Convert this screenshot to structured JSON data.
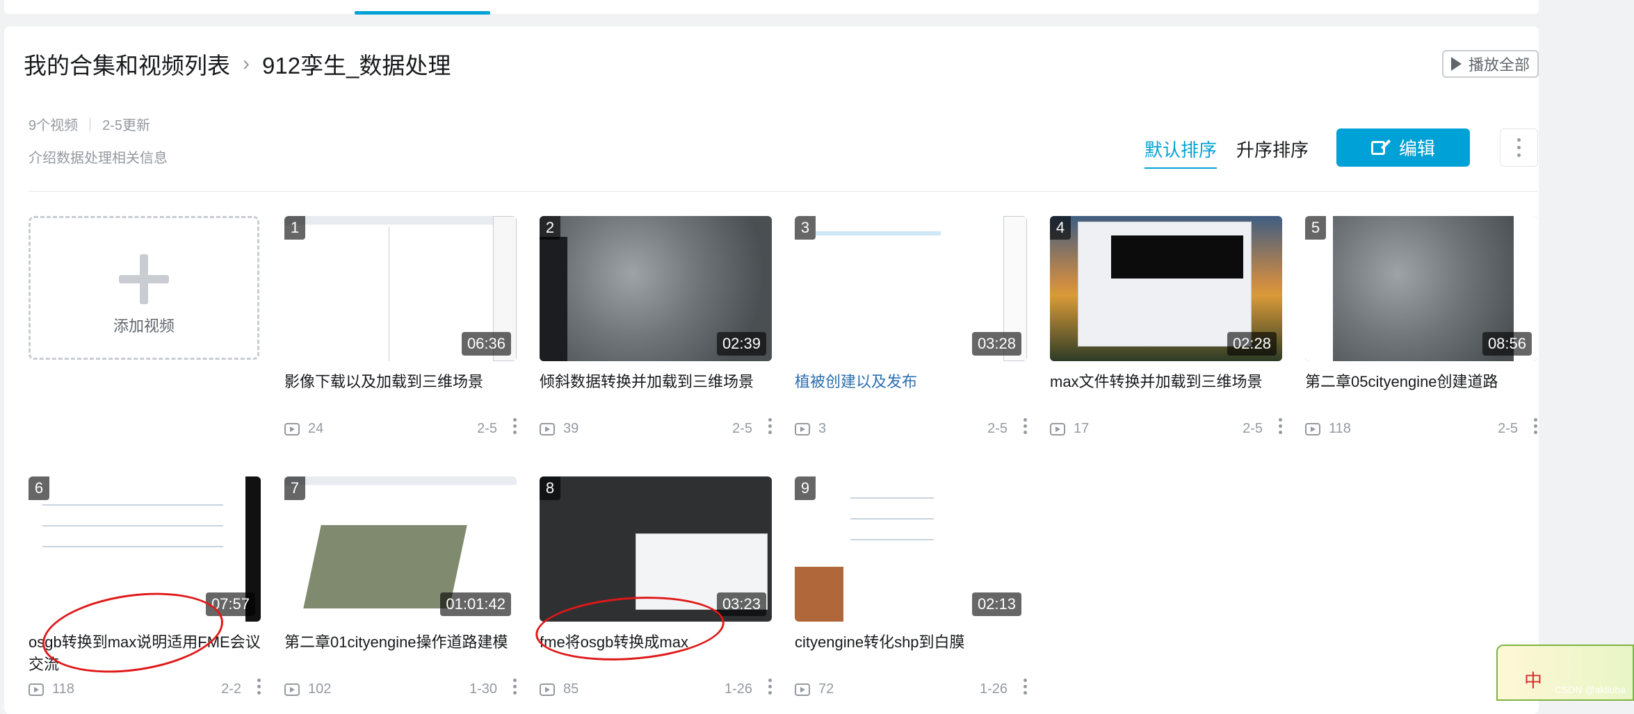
{
  "breadcrumb": {
    "root": "我的合集和视频列表",
    "current": "912孪生_数据处理"
  },
  "play_all": "播放全部",
  "meta": {
    "count": "9个视频",
    "updated": "2-5更新"
  },
  "description": "介绍数据处理相关信息",
  "sort": {
    "default": "默认排序",
    "asc": "升序排序"
  },
  "edit_label": "编辑",
  "add_video": "添加视频",
  "videos": [
    {
      "idx": "1",
      "duration": "06:36",
      "title": "影像下载以及加载到三维场景",
      "plays": "24",
      "date": "2-5"
    },
    {
      "idx": "2",
      "duration": "02:39",
      "title": "倾斜数据转换并加载到三维场景",
      "plays": "39",
      "date": "2-5"
    },
    {
      "idx": "3",
      "duration": "03:28",
      "title": "植被创建以及发布",
      "plays": "3",
      "date": "2-5"
    },
    {
      "idx": "4",
      "duration": "02:28",
      "title": "max文件转换并加载到三维场景",
      "plays": "17",
      "date": "2-5"
    },
    {
      "idx": "5",
      "duration": "08:56",
      "title": "第二章05cityengine创建道路",
      "plays": "118",
      "date": "2-5"
    },
    {
      "idx": "6",
      "duration": "07:57",
      "title": "osgb转换到max说明适用FME会议交流",
      "plays": "118",
      "date": "2-2"
    },
    {
      "idx": "7",
      "duration": "01:01:42",
      "title": "第二章01cityengine操作道路建模",
      "plays": "102",
      "date": "1-30"
    },
    {
      "idx": "8",
      "duration": "03:23",
      "title": "fme将osgb转换成max",
      "plays": "85",
      "date": "1-26"
    },
    {
      "idx": "9",
      "duration": "02:13",
      "title": "cityengine转化shp到白膜",
      "plays": "72",
      "date": "1-26"
    }
  ],
  "corner_badge": {
    "char": "中",
    "watermark": "CSDN @akliuba"
  },
  "colors": {
    "accent": "#00a1d6",
    "annotation": "#e01818"
  }
}
